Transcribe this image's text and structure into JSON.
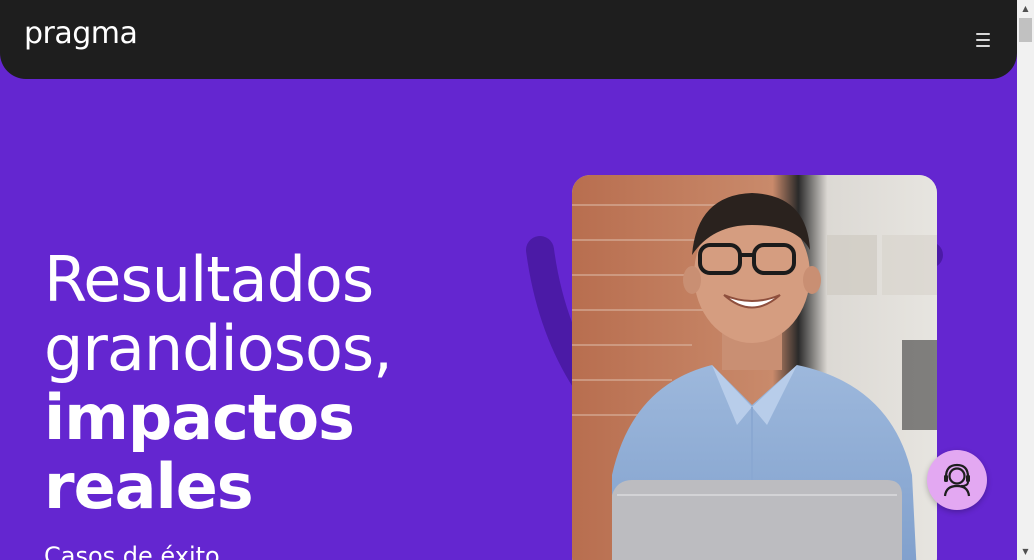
{
  "header": {
    "logo_text": "pragma",
    "menu_icon": "hamburger-menu-icon"
  },
  "hero": {
    "title_line1": "Resultados",
    "title_line2": "grandiosos,",
    "title_line3": "impactos",
    "title_line4": "reales",
    "subtitle": "Casos de éxito"
  },
  "support": {
    "icon": "support-agent-icon"
  },
  "colors": {
    "background": "#6426d0",
    "navbar": "#1e1e1e",
    "accent_arc": "#4b1aa6",
    "support_button": "#e3a8f2",
    "text": "#ffffff"
  }
}
